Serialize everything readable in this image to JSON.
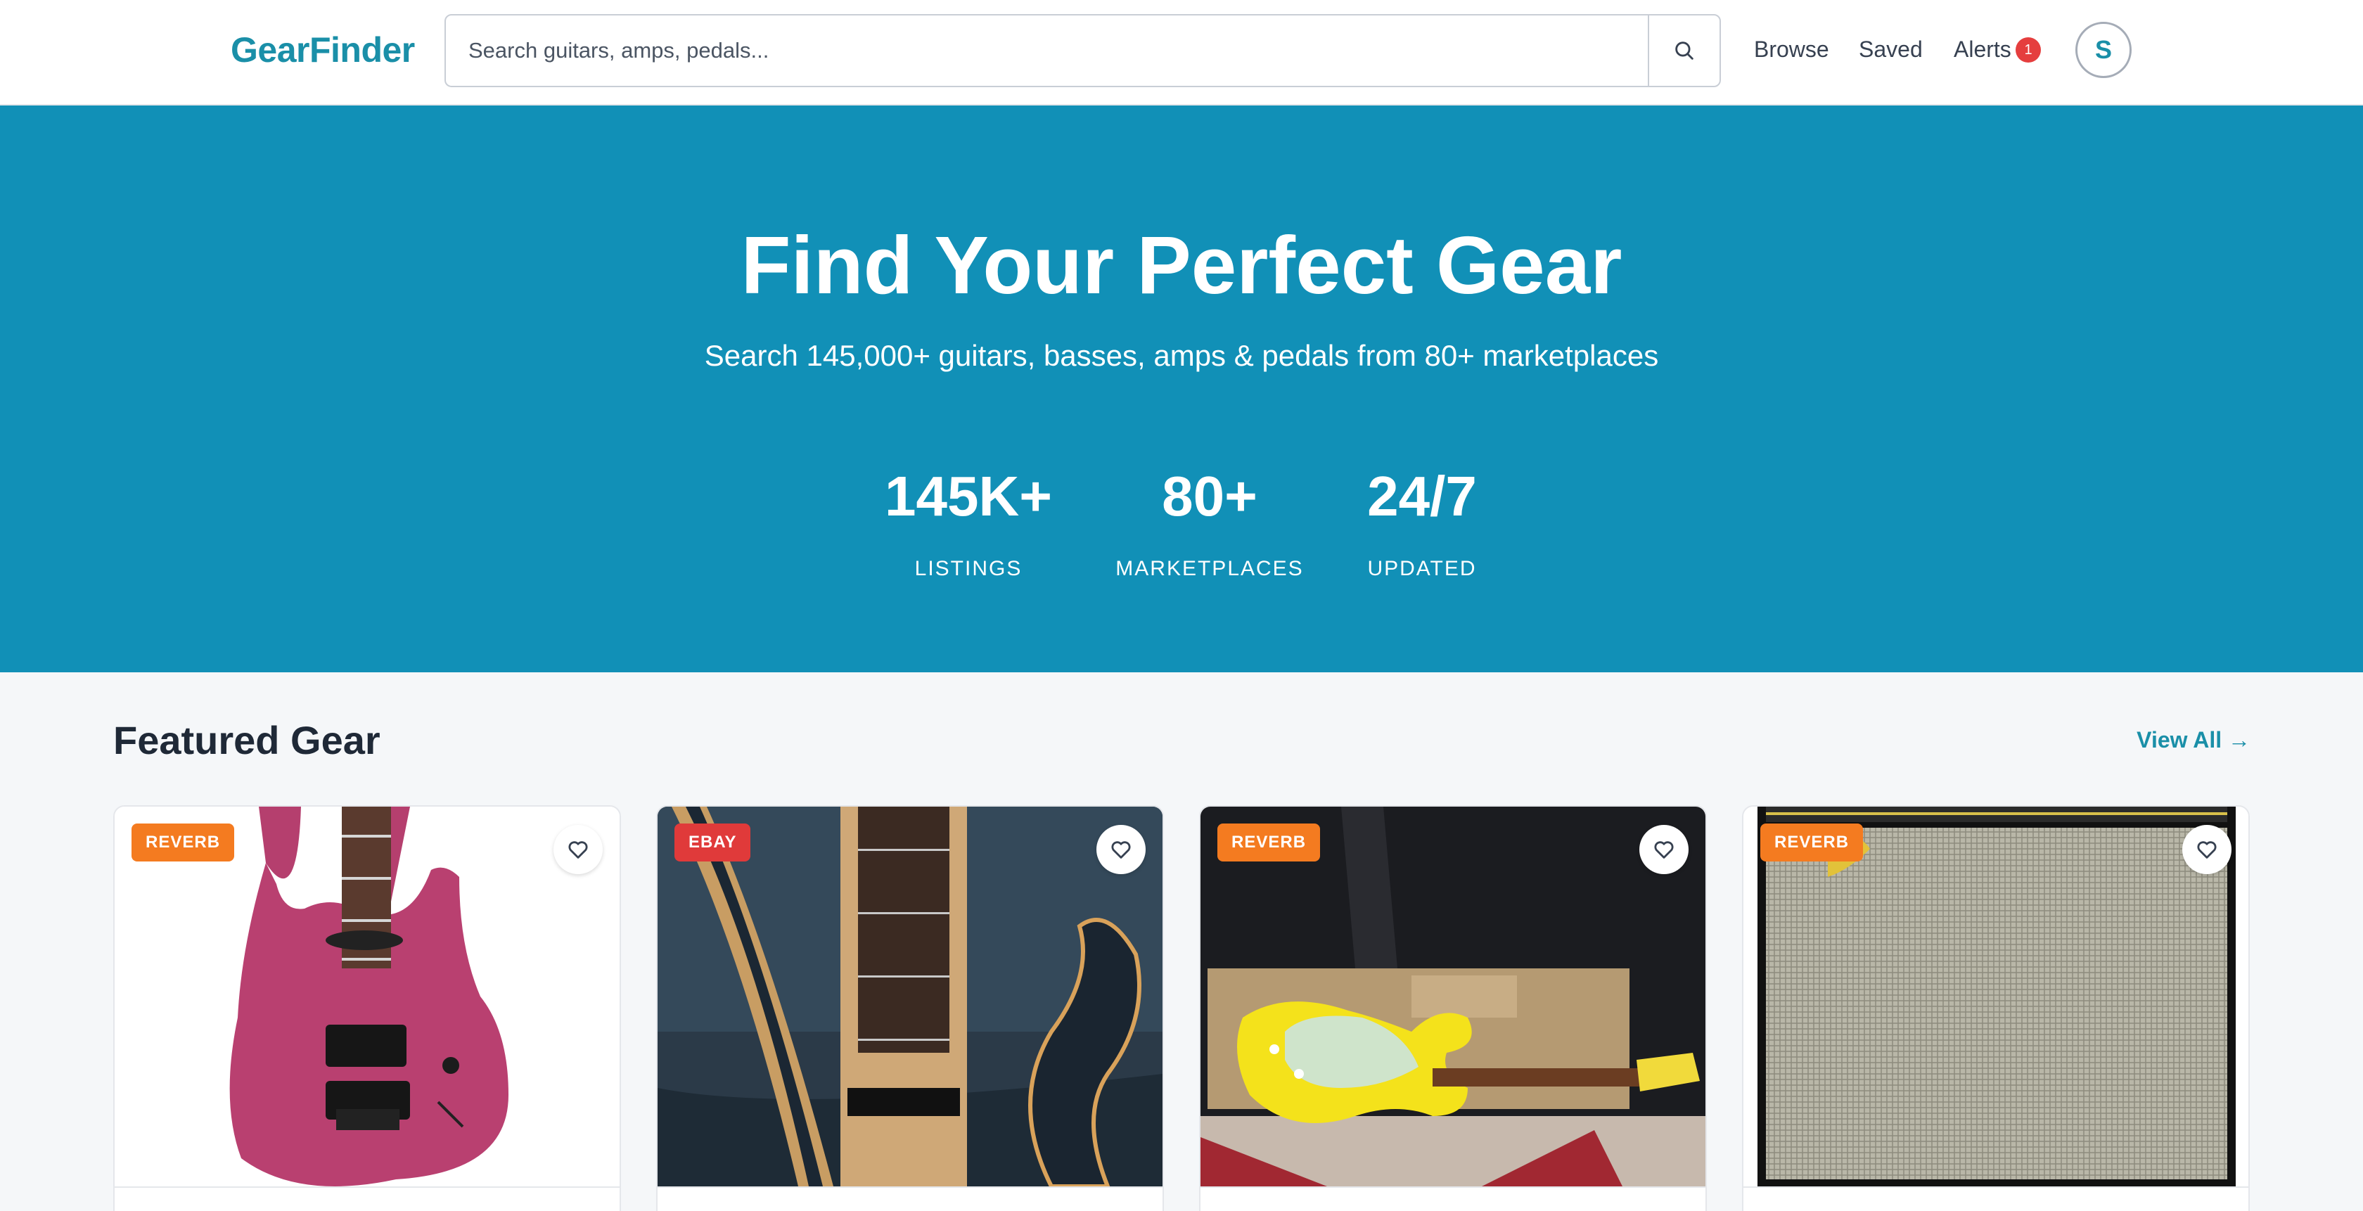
{
  "header": {
    "logo": "GearFinder",
    "search_placeholder": "Search guitars, amps, pedals...",
    "nav": {
      "browse": "Browse",
      "saved": "Saved",
      "alerts": "Alerts"
    },
    "alerts_count": "1",
    "avatar_initial": "S"
  },
  "hero": {
    "title": "Find Your Perfect Gear",
    "subtitle": "Search 145,000+ guitars, basses, amps & pedals from 80+ marketplaces",
    "stats": [
      {
        "value": "145K+",
        "label": "LISTINGS"
      },
      {
        "value": "80+",
        "label": "MARKETPLACES"
      },
      {
        "value": "24/7",
        "label": "UPDATED"
      }
    ]
  },
  "featured": {
    "title": "Featured Gear",
    "view_all": "View All →",
    "cards": [
      {
        "source": "REVERB",
        "badge_color": "#f47b20",
        "image": "pink-electric-guitar"
      },
      {
        "source": "EBAY",
        "badge_color": "#e03a3a",
        "image": "bass-guitar-closeup"
      },
      {
        "source": "REVERB",
        "badge_color": "#f47b20",
        "image": "yellow-stratocaster"
      },
      {
        "source": "REVERB",
        "badge_color": "#f47b20",
        "image": "amp-speaker-grille"
      }
    ]
  },
  "colors": {
    "brand": "#1a8fa8",
    "hero_bg": "#1190b7",
    "badge_red": "#e53e3e"
  },
  "icons": [
    "search-icon",
    "heart-icon"
  ]
}
